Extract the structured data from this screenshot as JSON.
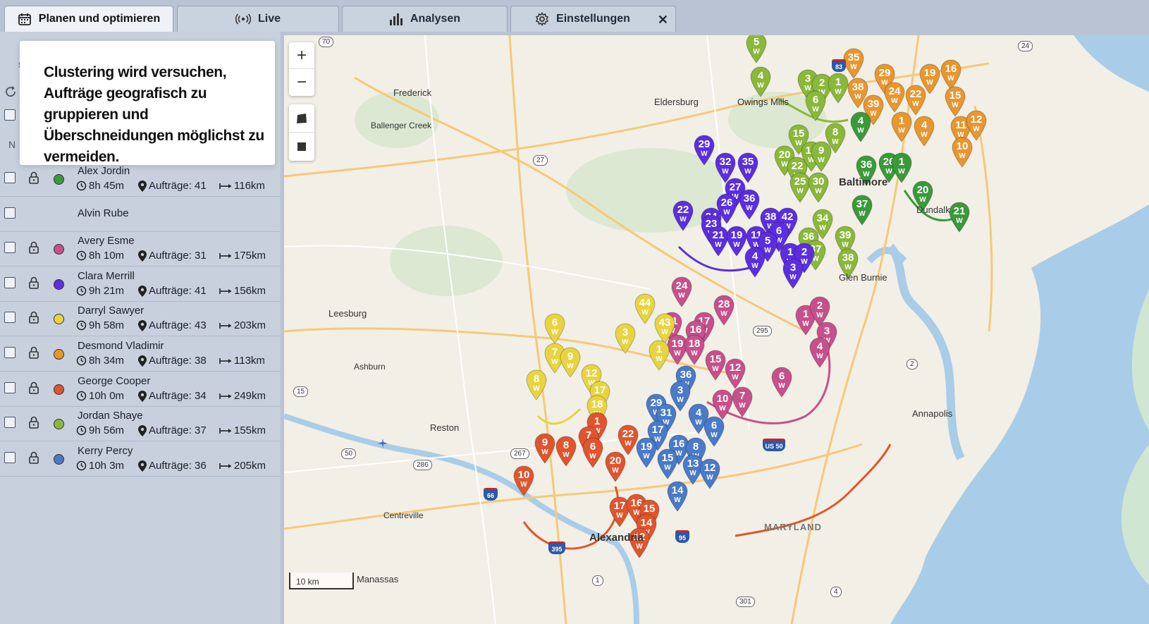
{
  "tabs": [
    {
      "label": "Planen und optimieren",
      "icon": "calendar-icon"
    },
    {
      "label": "Live",
      "icon": "broadcast-icon"
    },
    {
      "label": "Analysen",
      "icon": "bar-chart-icon"
    },
    {
      "label": "Einstellungen",
      "icon": "gear-icon"
    }
  ],
  "tooltip": {
    "text": "Clustering wird versuchen, Aufträge geografisch zu gruppieren und Überschneidungen möglichst zu vermeiden."
  },
  "sidebar_fragments": {
    "a": "s",
    "b": "N"
  },
  "drivers": [
    {
      "name": "Alex Jordin",
      "time": "8h 45m",
      "orders": "Aufträge: 41",
      "distance": "116km",
      "color": "#3a9a3a"
    },
    {
      "name": "Alvin Rube"
    },
    {
      "name": "Avery Esme",
      "time": "8h 10m",
      "orders": "Aufträge: 31",
      "distance": "175km",
      "color": "#c7508a"
    },
    {
      "name": "Clara Merrill",
      "time": "9h 21m",
      "orders": "Aufträge: 41",
      "distance": "156km",
      "color": "#5b2ee0"
    },
    {
      "name": "Darryl Sawyer",
      "time": "9h 58m",
      "orders": "Aufträge: 43",
      "distance": "203km",
      "color": "#e8d440"
    },
    {
      "name": "Desmond Vladimir",
      "time": "8h 34m",
      "orders": "Aufträge: 38",
      "distance": "113km",
      "color": "#e8962e"
    },
    {
      "name": "George Cooper",
      "time": "10h 0m",
      "orders": "Aufträge: 34",
      "distance": "249km",
      "color": "#e0552e"
    },
    {
      "name": "Jordan Shaye",
      "time": "9h 56m",
      "orders": "Aufträge: 37",
      "distance": "155km",
      "color": "#8ab83a"
    },
    {
      "name": "Kerry Percy",
      "time": "10h 3m",
      "orders": "Aufträge: 36",
      "distance": "205km",
      "color": "#4a7ac8"
    }
  ],
  "map": {
    "places": [
      "Frederick",
      "Eldersburg",
      "Owings Mills",
      "Ballenger Creek",
      "Leesburg",
      "Ashburn",
      "Reston",
      "Centreville",
      "Manassas",
      "Annapolis",
      "MARYLAND",
      "Glen Burnie",
      "Baltimore",
      "Dundalk",
      "Alexandria"
    ],
    "scale_label": "10 km",
    "shields": [
      "70",
      "83",
      "24",
      "27",
      "295",
      "15",
      "2",
      "267",
      "286",
      "50",
      "66",
      "395",
      "95",
      "US 50",
      "1",
      "4",
      "301"
    ],
    "pin_label": "W",
    "pins": [
      {
        "n": "5",
        "c": "#8ab83a"
      },
      {
        "n": "4",
        "c": "#8ab83a"
      },
      {
        "n": "3",
        "c": "#8ab83a"
      },
      {
        "n": "2",
        "c": "#8ab83a"
      },
      {
        "n": "1",
        "c": "#8ab83a"
      },
      {
        "n": "6",
        "c": "#8ab83a"
      },
      {
        "n": "15",
        "c": "#8ab83a"
      },
      {
        "n": "8",
        "c": "#8ab83a"
      },
      {
        "n": "20",
        "c": "#8ab83a"
      },
      {
        "n": "22",
        "c": "#8ab83a"
      },
      {
        "n": "12",
        "c": "#8ab83a"
      },
      {
        "n": "9",
        "c": "#8ab83a"
      },
      {
        "n": "25",
        "c": "#8ab83a"
      },
      {
        "n": "30",
        "c": "#8ab83a"
      },
      {
        "n": "34",
        "c": "#8ab83a"
      },
      {
        "n": "36",
        "c": "#8ab83a"
      },
      {
        "n": "37",
        "c": "#8ab83a"
      },
      {
        "n": "39",
        "c": "#8ab83a"
      },
      {
        "n": "38",
        "c": "#8ab83a"
      },
      {
        "n": "35",
        "c": "#e8962e"
      },
      {
        "n": "29",
        "c": "#e8962e"
      },
      {
        "n": "19",
        "c": "#e8962e"
      },
      {
        "n": "16",
        "c": "#e8962e"
      },
      {
        "n": "38",
        "c": "#e8962e"
      },
      {
        "n": "24",
        "c": "#e8962e"
      },
      {
        "n": "22",
        "c": "#e8962e"
      },
      {
        "n": "15",
        "c": "#e8962e"
      },
      {
        "n": "39",
        "c": "#e8962e"
      },
      {
        "n": "1",
        "c": "#e8962e"
      },
      {
        "n": "4",
        "c": "#e8962e"
      },
      {
        "n": "11",
        "c": "#e8962e"
      },
      {
        "n": "12",
        "c": "#e8962e"
      },
      {
        "n": "10",
        "c": "#e8962e"
      },
      {
        "n": "36",
        "c": "#3a9a3a"
      },
      {
        "n": "26",
        "c": "#3a9a3a"
      },
      {
        "n": "20",
        "c": "#3a9a3a"
      },
      {
        "n": "21",
        "c": "#3a9a3a"
      },
      {
        "n": "37",
        "c": "#3a9a3a"
      },
      {
        "n": "4",
        "c": "#3a9a3a"
      },
      {
        "n": "1",
        "c": "#3a9a3a"
      },
      {
        "n": "29",
        "c": "#5b2ee0"
      },
      {
        "n": "32",
        "c": "#5b2ee0"
      },
      {
        "n": "35",
        "c": "#5b2ee0"
      },
      {
        "n": "27",
        "c": "#5b2ee0"
      },
      {
        "n": "26",
        "c": "#5b2ee0"
      },
      {
        "n": "36",
        "c": "#5b2ee0"
      },
      {
        "n": "22",
        "c": "#5b2ee0"
      },
      {
        "n": "24",
        "c": "#5b2ee0"
      },
      {
        "n": "23",
        "c": "#5b2ee0"
      },
      {
        "n": "38",
        "c": "#5b2ee0"
      },
      {
        "n": "42",
        "c": "#5b2ee0"
      },
      {
        "n": "21",
        "c": "#5b2ee0"
      },
      {
        "n": "19",
        "c": "#5b2ee0"
      },
      {
        "n": "11",
        "c": "#5b2ee0"
      },
      {
        "n": "6",
        "c": "#5b2ee0"
      },
      {
        "n": "5",
        "c": "#5b2ee0"
      },
      {
        "n": "4",
        "c": "#5b2ee0"
      },
      {
        "n": "1",
        "c": "#5b2ee0"
      },
      {
        "n": "2",
        "c": "#5b2ee0"
      },
      {
        "n": "3",
        "c": "#5b2ee0"
      },
      {
        "n": "24",
        "c": "#c7508a"
      },
      {
        "n": "28",
        "c": "#c7508a"
      },
      {
        "n": "21",
        "c": "#c7508a"
      },
      {
        "n": "17",
        "c": "#c7508a"
      },
      {
        "n": "16",
        "c": "#c7508a"
      },
      {
        "n": "19",
        "c": "#c7508a"
      },
      {
        "n": "18",
        "c": "#c7508a"
      },
      {
        "n": "1",
        "c": "#c7508a"
      },
      {
        "n": "2",
        "c": "#c7508a"
      },
      {
        "n": "3",
        "c": "#c7508a"
      },
      {
        "n": "4",
        "c": "#c7508a"
      },
      {
        "n": "15",
        "c": "#c7508a"
      },
      {
        "n": "12",
        "c": "#c7508a"
      },
      {
        "n": "6",
        "c": "#c7508a"
      },
      {
        "n": "10",
        "c": "#c7508a"
      },
      {
        "n": "7",
        "c": "#c7508a"
      },
      {
        "n": "44",
        "c": "#e8d440"
      },
      {
        "n": "43",
        "c": "#e8d440"
      },
      {
        "n": "6",
        "c": "#e8d440"
      },
      {
        "n": "3",
        "c": "#e8d440"
      },
      {
        "n": "1",
        "c": "#e8d440"
      },
      {
        "n": "7",
        "c": "#e8d440"
      },
      {
        "n": "9",
        "c": "#e8d440"
      },
      {
        "n": "12",
        "c": "#e8d440"
      },
      {
        "n": "8",
        "c": "#e8d440"
      },
      {
        "n": "17",
        "c": "#e8d440"
      },
      {
        "n": "18",
        "c": "#e8d440"
      },
      {
        "n": "36",
        "c": "#4a7ac8"
      },
      {
        "n": "3",
        "c": "#4a7ac8"
      },
      {
        "n": "29",
        "c": "#4a7ac8"
      },
      {
        "n": "31",
        "c": "#4a7ac8"
      },
      {
        "n": "4",
        "c": "#4a7ac8"
      },
      {
        "n": "17",
        "c": "#4a7ac8"
      },
      {
        "n": "6",
        "c": "#4a7ac8"
      },
      {
        "n": "19",
        "c": "#4a7ac8"
      },
      {
        "n": "16",
        "c": "#4a7ac8"
      },
      {
        "n": "8",
        "c": "#4a7ac8"
      },
      {
        "n": "15",
        "c": "#4a7ac8"
      },
      {
        "n": "13",
        "c": "#4a7ac8"
      },
      {
        "n": "12",
        "c": "#4a7ac8"
      },
      {
        "n": "14",
        "c": "#4a7ac8"
      },
      {
        "n": "1",
        "c": "#e0552e"
      },
      {
        "n": "7",
        "c": "#e0552e"
      },
      {
        "n": "22",
        "c": "#e0552e"
      },
      {
        "n": "9",
        "c": "#e0552e"
      },
      {
        "n": "8",
        "c": "#e0552e"
      },
      {
        "n": "6",
        "c": "#e0552e"
      },
      {
        "n": "20",
        "c": "#e0552e"
      },
      {
        "n": "10",
        "c": "#e0552e"
      },
      {
        "n": "17",
        "c": "#e0552e"
      },
      {
        "n": "16",
        "c": "#e0552e"
      },
      {
        "n": "15",
        "c": "#e0552e"
      },
      {
        "n": "14",
        "c": "#e0552e"
      },
      {
        "n": "12",
        "c": "#e0552e"
      }
    ]
  }
}
